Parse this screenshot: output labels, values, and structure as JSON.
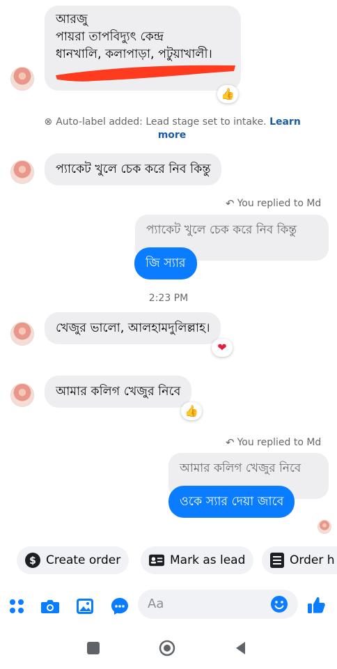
{
  "messages": {
    "m1": {
      "lines": [
        "আরজু",
        "পায়রা তাপবিদ্যুৎ কেন্দ্র",
        "ধানখালি, কলাপাড়া, পটুয়াখালী।"
      ],
      "reaction": "thumbs-up"
    },
    "system_label": {
      "text": "Auto-label added: Lead stage set to intake.",
      "link": "Learn more"
    },
    "m2": {
      "text": "প্যাকেট খুলে চেক করে নিব কিন্তু"
    },
    "reply1": {
      "replied_label": "You replied to Md",
      "quoted": "প্যাকেট খুলে চেক করে নিব কিন্তু",
      "text": "জি স্যার"
    },
    "timestamp": "2:23 PM",
    "m3": {
      "text": "খেজুর ভালো, আলহামদুলিল্লাহ।",
      "reaction": "heart"
    },
    "m4": {
      "text": "আমার কলিগ খেজুর নিবে",
      "reaction": "thumbs-up"
    },
    "reply2": {
      "replied_label": "You replied to Md",
      "quoted": "আমার কলিগ খেজুর নিবে",
      "text": "ওকে স্যার দেয়া জাবে"
    }
  },
  "quick_actions": [
    {
      "label": "Create order",
      "icon": "dollar-icon"
    },
    {
      "label": "Mark as lead",
      "icon": "id-card-icon"
    },
    {
      "label": "Order h",
      "icon": "list-icon"
    }
  ],
  "composer": {
    "placeholder": "Aa"
  },
  "colors": {
    "accent": "#0a7cff",
    "incoming_bubble": "#eeeef1",
    "redaction": "#ff3b1f"
  }
}
